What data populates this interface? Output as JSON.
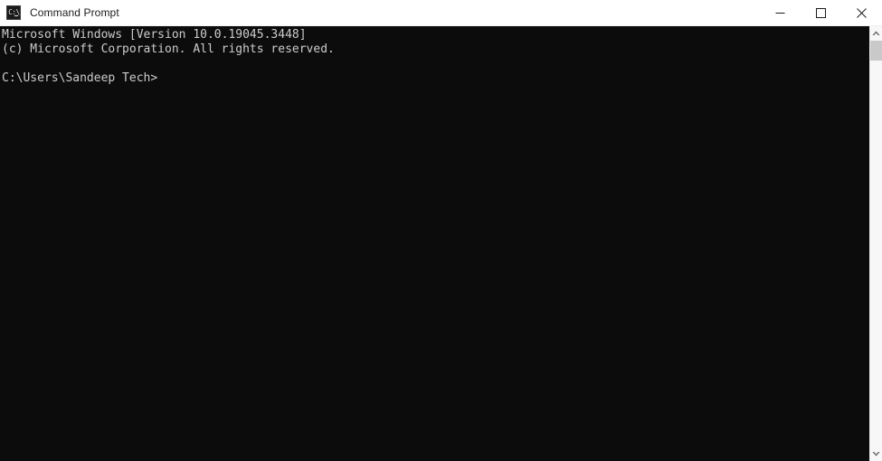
{
  "window": {
    "title": "Command Prompt",
    "icon": "command-prompt-icon",
    "icon_glyph": "C:\\",
    "titlebar_bg": "#ffffff",
    "titlebar_fg": "#1b1b1b",
    "console_bg": "#0c0c0c",
    "console_fg": "#cccccc"
  },
  "titlebar": {
    "buttons": [
      {
        "name": "minimize-button",
        "label": "Minimize",
        "glyph": "minimize-icon"
      },
      {
        "name": "maximize-button",
        "label": "Maximize",
        "glyph": "maximize-icon"
      },
      {
        "name": "close-button",
        "label": "Close",
        "glyph": "close-icon"
      }
    ]
  },
  "console": {
    "lines": [
      "Microsoft Windows [Version 10.0.19045.3448]",
      "(c) Microsoft Corporation. All rights reserved.",
      "",
      "C:\\Users\\Sandeep Tech>"
    ],
    "text": "Microsoft Windows [Version 10.0.19045.3448]\n(c) Microsoft Corporation. All rights reserved.\n\nC:\\Users\\Sandeep Tech>",
    "version_line": "Microsoft Windows [Version 10.0.19045.3448]",
    "copyright_line": "(c) Microsoft Corporation. All rights reserved.",
    "prompt_line": "C:\\Users\\Sandeep Tech>",
    "current_directory": "C:\\Users\\Sandeep Tech",
    "command_input": ""
  },
  "scrollbar": {
    "up_arrow": "chevron-up-icon",
    "down_arrow": "chevron-down-icon",
    "thumb_position_percent": 0,
    "thumb_size_percent": 5
  }
}
